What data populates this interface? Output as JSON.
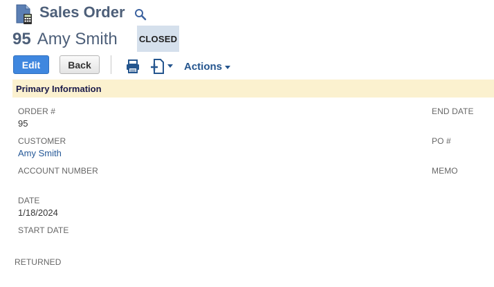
{
  "header": {
    "title": "Sales Order",
    "record_number": "95",
    "record_name": "Amy Smith",
    "status": "CLOSED"
  },
  "toolbar": {
    "edit_label": "Edit",
    "back_label": "Back",
    "actions_label": "Actions"
  },
  "section": {
    "title": "Primary Information"
  },
  "fields": {
    "order_num": {
      "label": "ORDER #",
      "value": "95"
    },
    "customer": {
      "label": "CUSTOMER",
      "value": "Amy Smith"
    },
    "account_number": {
      "label": "ACCOUNT NUMBER",
      "value": ""
    },
    "date": {
      "label": "DATE",
      "value": "1/18/2024"
    },
    "start_date": {
      "label": "START DATE",
      "value": ""
    },
    "end_date": {
      "label": "END DATE",
      "value": ""
    },
    "po_num": {
      "label": "PO #",
      "value": ""
    },
    "memo": {
      "label": "MEMO",
      "value": ""
    },
    "returned": {
      "label": "RETURNED",
      "value": ""
    }
  },
  "colors": {
    "title": "#4d5f79",
    "edit_button": "#3f87df",
    "link": "#255897",
    "status_badge": "#d5e0ec",
    "section_bar": "#fbf1cf"
  },
  "icons": {
    "page": "calculator-document-icon",
    "search": "search-icon",
    "print": "printer-icon",
    "new_document": "new-document-icon"
  }
}
